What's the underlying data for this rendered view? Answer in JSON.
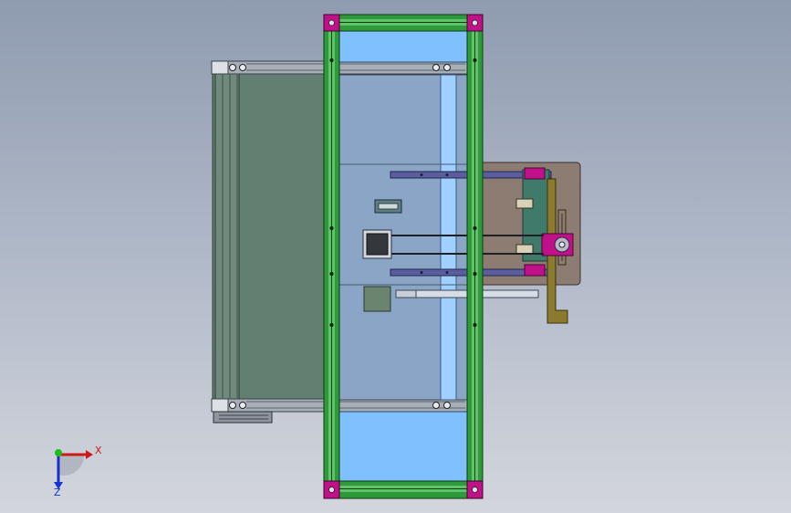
{
  "viewport": {
    "background_top": "#8f9bb0",
    "background_bottom": "#d3d6dc"
  },
  "colors": {
    "conveyor_belt": "#637f72",
    "conveyor_frame": "#a6aeb8",
    "panel_blue": "#8aa5c6",
    "window_blue": "#80c0ff",
    "extrusion_green": "#2e9a3a",
    "corner_magenta": "#c0108a",
    "gripper_plate": "#8c7c72",
    "bracket_olive": "#8a7a2e",
    "rail_violet": "#5a5e9e"
  },
  "triad": {
    "x_label": "X",
    "z_label": "Z",
    "x_color": "#d01818",
    "y_color": "#18c018",
    "z_color": "#1830d0"
  }
}
